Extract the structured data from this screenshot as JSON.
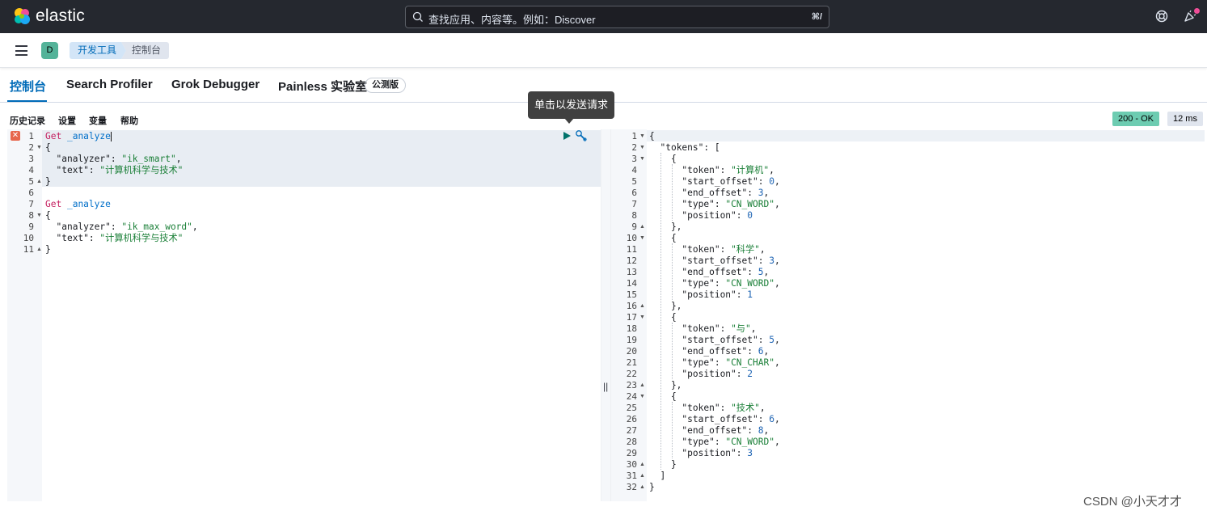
{
  "header": {
    "brand": "elastic",
    "search_placeholder": "查找应用、内容等。例如：Discover",
    "search_shortcut": "⌘/"
  },
  "breadcrumb": {
    "space_initial": "D",
    "items": [
      "开发工具",
      "控制台"
    ]
  },
  "tabs": [
    {
      "label": "控制台",
      "active": true
    },
    {
      "label": "Search Profiler",
      "active": false
    },
    {
      "label": "Grok Debugger",
      "active": false
    },
    {
      "label": "Painless 实验室",
      "active": false
    }
  ],
  "beta_badge": "公测版",
  "toolbar": {
    "history": "历史记录",
    "settings": "设置",
    "variables": "变量",
    "help": "帮助"
  },
  "tooltip": "单击以发送请求",
  "response_status": "200 - OK",
  "response_time": "12 ms",
  "request_lines": [
    "Get _analyze",
    "{",
    "  \"analyzer\": \"ik_smart\",",
    "  \"text\": \"计算机科学与技术\"",
    "}",
    "",
    "Get _analyze",
    "{",
    "  \"analyzer\": \"ik_max_word\",",
    "  \"text\": \"计算机科学与技术\"",
    "}"
  ],
  "response_lines": [
    "{",
    "  \"tokens\": [",
    "    {",
    "      \"token\": \"计算机\",",
    "      \"start_offset\": 0,",
    "      \"end_offset\": 3,",
    "      \"type\": \"CN_WORD\",",
    "      \"position\": 0",
    "    },",
    "    {",
    "      \"token\": \"科学\",",
    "      \"start_offset\": 3,",
    "      \"end_offset\": 5,",
    "      \"type\": \"CN_WORD\",",
    "      \"position\": 1",
    "    },",
    "    {",
    "      \"token\": \"与\",",
    "      \"start_offset\": 5,",
    "      \"end_offset\": 6,",
    "      \"type\": \"CN_CHAR\",",
    "      \"position\": 2",
    "    },",
    "    {",
    "      \"token\": \"技术\",",
    "      \"start_offset\": 6,",
    "      \"end_offset\": 8,",
    "      \"type\": \"CN_WORD\",",
    "      \"position\": 3",
    "    }",
    "  ]",
    "}"
  ],
  "request_folds": {
    "2": "open",
    "5": "close",
    "8": "open",
    "11": "close"
  },
  "response_folds": {
    "1": "open",
    "2": "open",
    "3": "open",
    "9": "close",
    "10": "open",
    "16": "close",
    "17": "open",
    "23": "close",
    "24": "open",
    "30": "close",
    "31": "close",
    "32": "close"
  },
  "watermark": "CSDN @小天才才"
}
